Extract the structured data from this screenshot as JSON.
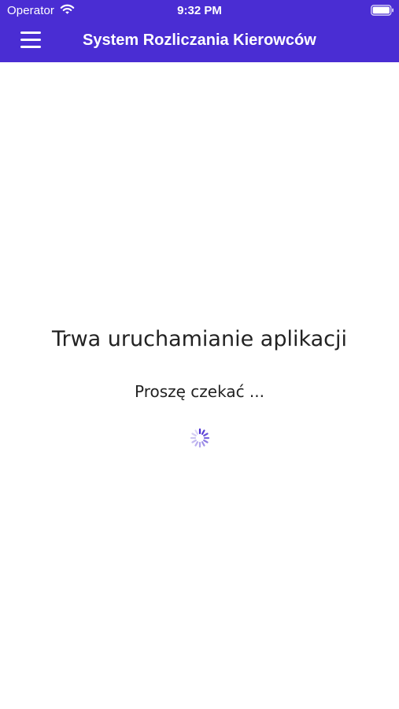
{
  "status_bar": {
    "carrier": "Operator",
    "time": "9:32 PM",
    "icons": [
      "wifi-icon",
      "battery-icon"
    ]
  },
  "nav": {
    "menu_icon": "hamburger-menu-icon",
    "title": "System Rozliczania Kierowców"
  },
  "loading": {
    "title": "Trwa uruchamianie aplikacji",
    "subtitle": "Proszę czekać ...",
    "spinner_icon": "loading-spinner-icon"
  },
  "colors": {
    "header_background": "#4a2dd3",
    "header_text": "#ffffff",
    "page_background": "#ffffff",
    "body_text": "#222222",
    "spinner": "#4a2dd3"
  }
}
